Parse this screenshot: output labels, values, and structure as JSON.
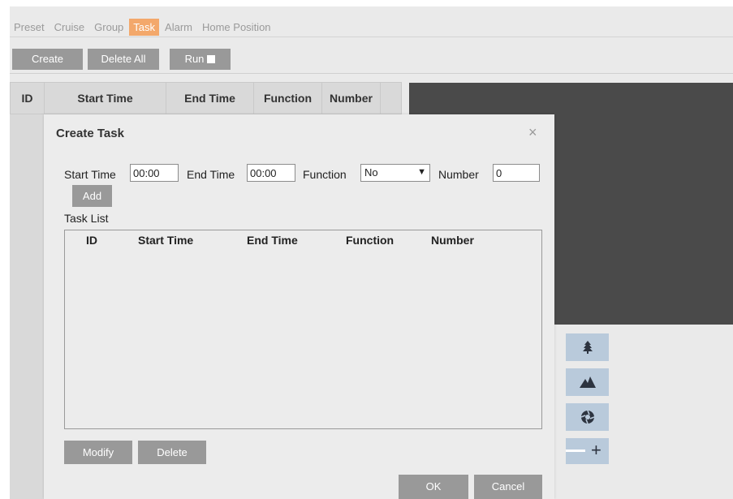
{
  "tabs": [
    {
      "label": "Preset",
      "active": false
    },
    {
      "label": "Cruise",
      "active": false
    },
    {
      "label": "Group",
      "active": false
    },
    {
      "label": "Task",
      "active": true
    },
    {
      "label": "Alarm",
      "active": false
    },
    {
      "label": "Home Position",
      "active": false
    }
  ],
  "toolbar": {
    "create_label": "Create",
    "delete_all_label": "Delete All",
    "run_label": "Run",
    "run_checked": false
  },
  "task_table": {
    "columns": [
      "ID",
      "Start Time",
      "End Time",
      "Function",
      "Number"
    ]
  },
  "ptz": {
    "buttons": [
      "tree-icon",
      "mountain-icon",
      "aperture-icon"
    ],
    "zoom_plus": "+"
  },
  "dialog": {
    "title": "Create Task",
    "close_symbol": "×",
    "start_time_label": "Start Time",
    "start_time_value": "00:00",
    "end_time_label": "End Time",
    "end_time_value": "00:00",
    "function_label": "Function",
    "function_value": "No",
    "number_label": "Number",
    "number_value": "0",
    "add_label": "Add",
    "task_list_label": "Task List",
    "task_list_columns": [
      "ID",
      "Start Time",
      "End Time",
      "Function",
      "Number"
    ],
    "modify_label": "Modify",
    "delete_label": "Delete",
    "ok_label": "OK",
    "cancel_label": "Cancel"
  },
  "colors": {
    "active_tab": "#f3a86b",
    "button_gray": "#999999",
    "video_bg": "#4a4a4a",
    "ptz_button": "#b9cadb"
  }
}
